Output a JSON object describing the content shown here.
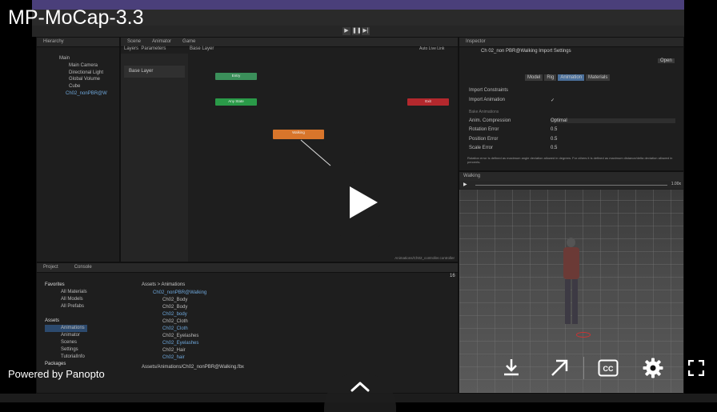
{
  "video": {
    "title": "MP-MoCap-3.3",
    "powered_by": "Powered by Panopto",
    "controls": [
      "download",
      "share",
      "captions",
      "settings",
      "fullscreen"
    ]
  },
  "unity": {
    "hierarchy": {
      "tab": "Hierarchy",
      "items": [
        "Main",
        "Main Camera",
        "Directional Light",
        "Global Volume",
        "Cube",
        "Ch02_nonPBR@W"
      ]
    },
    "scene_tabs": [
      "Scene",
      "Animator",
      "Game"
    ],
    "animator": {
      "layers_tab": "Layers",
      "parameters_tab": "Parameters",
      "breadcrumb": "Base Layer",
      "auto_live_link": "Auto Live Link",
      "base_layer": "Base Layer",
      "path": "Animations/Ch02_controller.controller",
      "states": {
        "entry": "Entry",
        "any": "Any State",
        "exit": "Exit",
        "walking": "Walking"
      }
    },
    "inspector": {
      "tab": "Inspector",
      "title": "Ch 02_non PBR@Walking Import Settings",
      "open": "Open",
      "tabs": [
        "Model",
        "Rig",
        "Animation",
        "Materials"
      ],
      "rows": [
        {
          "label": "Import Constraints",
          "value": ""
        },
        {
          "label": "Import Animation",
          "value": "✓"
        },
        {
          "label": "Anim. Compression",
          "value": "Optimal"
        },
        {
          "label": "Rotation Error",
          "value": "0.5"
        },
        {
          "label": "Position Error",
          "value": "0.5"
        },
        {
          "label": "Scale Error",
          "value": "0.5"
        }
      ],
      "section": "Bake Animations",
      "note": "Rotation error is defined as maximum angle deviation allowed in degrees. For others it is defined as maximum distance/delta deviation allowed in percents."
    },
    "preview": {
      "label": "Walking",
      "speed": "1.00x"
    },
    "project": {
      "tabs": [
        "Project",
        "Console"
      ],
      "favorites": [
        "Favorites",
        "All Materials",
        "All Models",
        "All Prefabs"
      ],
      "assets": [
        "Assets",
        "Animations",
        "Animator",
        "Scenes",
        "Settings",
        "TutorialInfo",
        "Packages"
      ],
      "breadcrumb": "Assets > Animations",
      "files": [
        "Ch02_nonPBR@Walking",
        "Ch02_Body",
        "Ch02_Body",
        "Ch02_body",
        "Ch02_Cloth",
        "Ch02_Cloth",
        "Ch02_Eyelashes",
        "Ch02_Eyelashes",
        "Ch02_Hair",
        "Ch02_hair"
      ],
      "footer": "Assets/Animations/Ch02_nonPBR@Walking.fbx",
      "count": "16"
    }
  }
}
